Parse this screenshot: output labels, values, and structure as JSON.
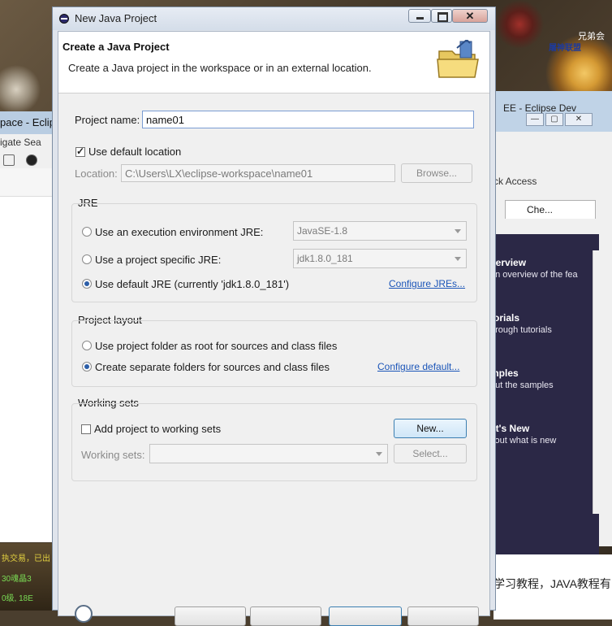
{
  "background": {
    "game_text_top": "兄弟会",
    "game_text_sub": "屠神联盟",
    "game_bottom_1": "执交易，已出",
    "game_bottom_2": "30魂晶3",
    "game_bottom_3": "0级, 18E"
  },
  "left_window": {
    "title": "pace - Eclip",
    "menu": "igate   Sea"
  },
  "right_window": {
    "title": "EE - Eclipse Dev",
    "quick_access": "ck Access",
    "tab_label": "Che...",
    "welcome_items": [
      {
        "title": "verview",
        "desc": "an overview of the fea"
      },
      {
        "title": "torials",
        "desc": "hrough tutorials"
      },
      {
        "title": "mples",
        "desc": "out the samples"
      },
      {
        "title": "at's New",
        "desc": "l out what is new"
      }
    ],
    "logo": "ec",
    "bottom_text": "学习教程，JAVA教程有"
  },
  "dialog": {
    "title": "New Java Project",
    "banner_title": "Create a Java Project",
    "banner_desc": "Create a Java project in the workspace or in an external location.",
    "project_name_label": "Project name:",
    "project_name_value": "name01",
    "use_default_location_label": "Use default location",
    "use_default_location_checked": true,
    "location_label": "Location:",
    "location_value": "C:\\Users\\LX\\eclipse-workspace\\name01",
    "browse_label": "Browse...",
    "jre": {
      "group_label": "JRE",
      "option_env_label": "Use an execution environment JRE:",
      "option_env_value": "JavaSE-1.8",
      "option_specific_label": "Use a project specific JRE:",
      "option_specific_value": "jdk1.8.0_181",
      "option_default_label": "Use default JRE (currently 'jdk1.8.0_181')",
      "selected": "default",
      "configure_link": "Configure JREs..."
    },
    "layout": {
      "group_label": "Project layout",
      "option_root_label": "Use project folder as root for sources and class files",
      "option_separate_label": "Create separate folders for sources and class files",
      "selected": "separate",
      "configure_link": "Configure default..."
    },
    "working_sets": {
      "group_label": "Working sets",
      "add_label": "Add project to working sets",
      "add_checked": false,
      "new_button": "New...",
      "sets_label": "Working sets:",
      "sets_value": "",
      "select_button": "Select..."
    }
  }
}
